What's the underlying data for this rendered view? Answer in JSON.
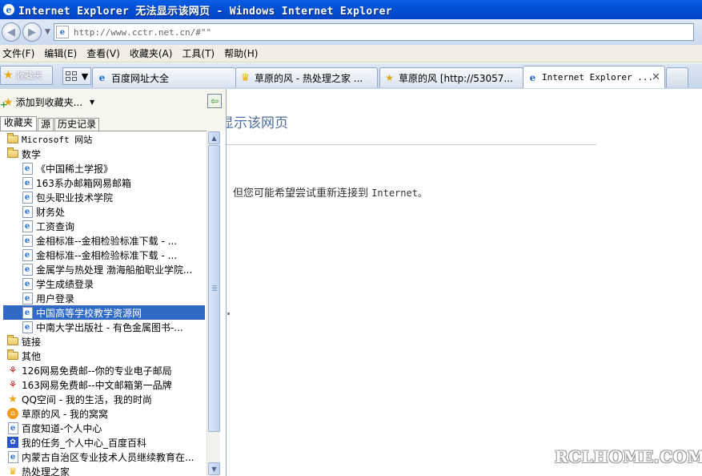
{
  "window": {
    "title": "Internet Explorer 无法显示该网页 - Windows Internet Explorer"
  },
  "address": {
    "url": "http://www.cctr.net.cn/#\"\""
  },
  "menu": [
    "文件(F)",
    "编辑(E)",
    "查看(V)",
    "收藏夹(A)",
    "工具(T)",
    "帮助(H)"
  ],
  "tabbar": {
    "favorites_label": "收藏夹",
    "tabs": [
      {
        "label": "百度网址大全",
        "icon": "ie-icon"
      },
      {
        "label": "草原的风 - 热处理之家 ...",
        "icon": "trophy-icon"
      },
      {
        "label": "草原的风 [http://53057...",
        "icon": "star-icon"
      },
      {
        "label": "Internet Explorer ...",
        "icon": "ie-icon",
        "active": true
      }
    ]
  },
  "favorites": {
    "add_label": "添加到收藏夹...",
    "tabs": [
      "收藏夹",
      "源",
      "历史记录"
    ],
    "items": [
      {
        "label": "Microsoft 网站",
        "type": "folder",
        "level": 0,
        "mono": true
      },
      {
        "label": "数学",
        "type": "folder",
        "level": 0
      },
      {
        "label": "《中国稀土学报》",
        "type": "ie",
        "level": 1
      },
      {
        "label": "163系办邮箱网易邮箱",
        "type": "ie",
        "level": 1
      },
      {
        "label": "包头职业技术学院",
        "type": "ie",
        "level": 1
      },
      {
        "label": "财务处",
        "type": "ie",
        "level": 1
      },
      {
        "label": "工资查询",
        "type": "ie",
        "level": 1
      },
      {
        "label": "金相标准--金相检验标准下载 - ...",
        "type": "ie",
        "level": 1
      },
      {
        "label": "金相标准--金相检验标准下载 - ...",
        "type": "ie",
        "level": 1
      },
      {
        "label": "金属学与热处理 渤海船舶职业学院...",
        "type": "ie",
        "level": 1
      },
      {
        "label": "学生成绩登录",
        "type": "ie",
        "level": 1
      },
      {
        "label": "用户登录",
        "type": "ie",
        "level": 1
      },
      {
        "label": "中国高等学校教学资源网",
        "type": "ie",
        "level": 1,
        "selected": true
      },
      {
        "label": "中南大学出版社 - 有色金属图书-...",
        "type": "ie",
        "level": 1
      },
      {
        "label": "链接",
        "type": "folder",
        "level": 0
      },
      {
        "label": "其他",
        "type": "folder",
        "level": 0
      },
      {
        "label": "126网易免费邮--你的专业电子邮局",
        "type": "net",
        "level": 0
      },
      {
        "label": "163网易免费邮--中文邮箱第一品牌",
        "type": "net",
        "level": 0
      },
      {
        "label": "QQ空间 - 我的生活，我的时尚",
        "type": "qq",
        "level": 0
      },
      {
        "label": "草原的风 - 我的窝窝",
        "type": "home",
        "level": 0
      },
      {
        "label": "百度知道-个人中心",
        "type": "ie",
        "level": 0
      },
      {
        "label": "我的任务_个人中心_百度百科",
        "type": "paw",
        "level": 0
      },
      {
        "label": "内蒙古自治区专业技术人员继续教育在...",
        "type": "ie",
        "level": 0
      },
      {
        "label": "热处理之家",
        "type": "cup",
        "level": 0
      }
    ]
  },
  "content": {
    "heading": "显示该网页",
    "body_text": "但您可能希望尝试重新连接到 ",
    "body_mono": "Internet。"
  },
  "watermark": "RCLHOME.COM"
}
